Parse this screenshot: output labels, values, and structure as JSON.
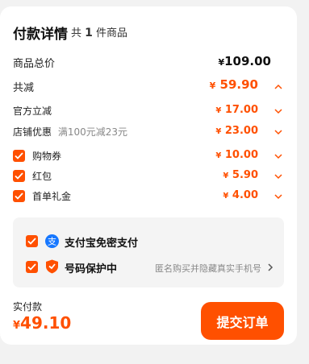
{
  "header": {
    "title": "付款详情",
    "count_prefix": "共",
    "count": "1",
    "count_suffix": "件商品"
  },
  "rows": {
    "total": {
      "label": "商品总价",
      "currency": "¥",
      "value": "109.00"
    },
    "reduce": {
      "label": "共减",
      "currency": "¥",
      "value": "59.90"
    },
    "official": {
      "label": "官方立减",
      "currency": "¥",
      "value": "17.00"
    },
    "shop": {
      "label": "店铺优惠",
      "note": "满100元减23元",
      "currency": "¥",
      "value": "23.00"
    },
    "coupon": {
      "label": "购物券",
      "currency": "¥",
      "value": "10.00"
    },
    "redpacket": {
      "label": "红包",
      "currency": "¥",
      "value": "5.90"
    },
    "firstorder": {
      "label": "首单礼金",
      "currency": "¥",
      "value": "4.00"
    }
  },
  "payment": {
    "alipay_label": "支付宝免密支付",
    "privacy_label": "号码保护中",
    "privacy_note": "匿名购买并隐藏真实手机号"
  },
  "footer": {
    "paid_label": "实付款",
    "currency": "¥",
    "paid_value": "49.10",
    "submit_label": "提交订单"
  },
  "colors": {
    "accent": "#ff5000",
    "alipay": "#1677ff"
  }
}
